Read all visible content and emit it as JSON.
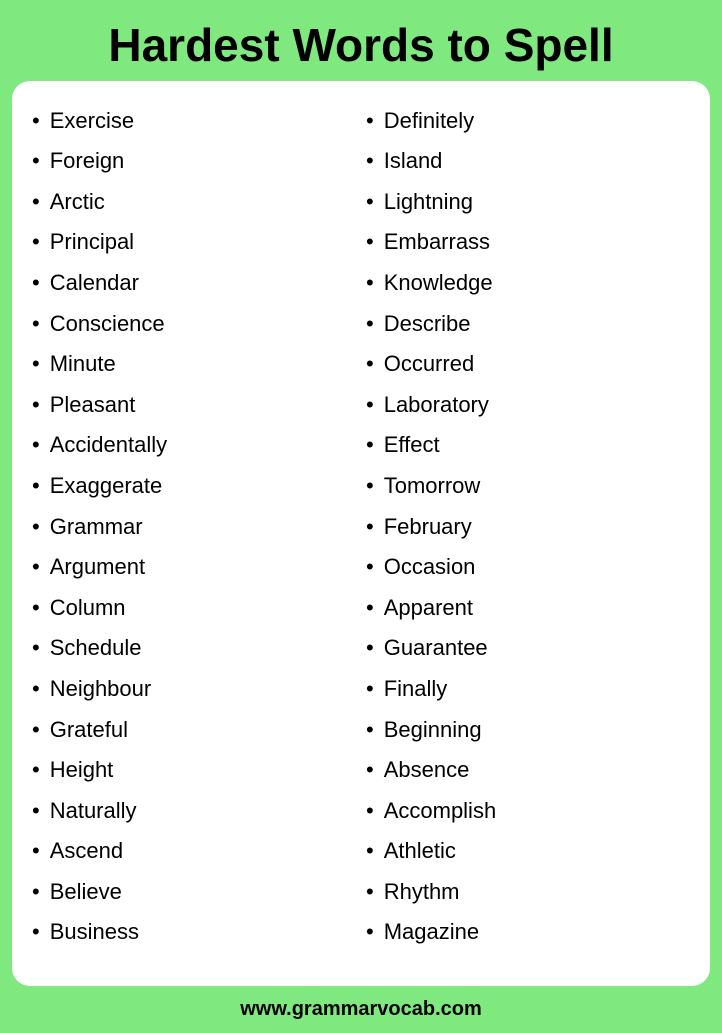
{
  "header": {
    "title": "Hardest Words to Spell"
  },
  "left_column": [
    "Exercise",
    "Foreign",
    "Arctic",
    "Principal",
    "Calendar",
    "Conscience",
    "Minute",
    "Pleasant",
    "Accidentally",
    "Exaggerate",
    "Grammar",
    "Argument",
    "Column",
    "Schedule",
    "Neighbour",
    "Grateful",
    "Height",
    "Naturally",
    "Ascend",
    "Believe",
    "Business"
  ],
  "right_column": [
    "Definitely",
    "Island",
    "Lightning",
    "Embarrass",
    "Knowledge",
    "Describe",
    "Occurred",
    "Laboratory",
    "Effect",
    "Tomorrow",
    "February",
    "Occasion",
    "Apparent",
    "Guarantee",
    "Finally",
    "Beginning",
    "Absence",
    "Accomplish",
    "Athletic",
    "Rhythm",
    "Magazine"
  ],
  "footer": {
    "url": "www.grammarvocab.com"
  },
  "bullet": "•"
}
